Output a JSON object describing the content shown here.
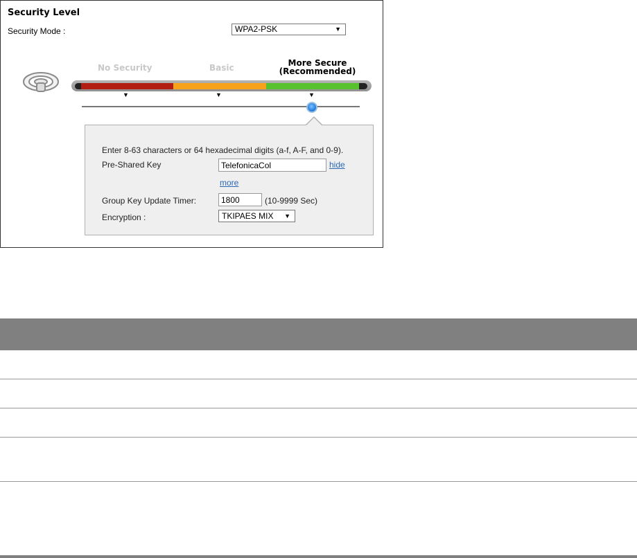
{
  "security_panel": {
    "title": "Security Level",
    "mode_label": "Security Mode :",
    "mode_value": "WPA2-PSK",
    "levels": {
      "none": "No Security",
      "basic": "Basic",
      "secure_line1": "More Secure",
      "secure_line2": "(Recommended)"
    },
    "selected_level": "More Secure",
    "colors": {
      "red": "#b31e12",
      "orange": "#f7a21a",
      "green": "#57c22d",
      "knob": "#1b78d9",
      "link": "#2a68b5"
    }
  },
  "details": {
    "hint": "Enter 8-63 characters or 64 hexadecimal digits (a-f, A-F, and 0-9).",
    "psk_label": "Pre-Shared Key",
    "psk_value": "TelefonicaCol",
    "hide_link": "hide",
    "more_link": "more",
    "timer_label": "Group Key Update Timer:",
    "timer_value": "1800",
    "timer_unit": "(10-9999 Sec)",
    "encryption_label": "Encryption :",
    "encryption_value": "TKIPAES MIX"
  },
  "icons": [
    "router-icon",
    "dropdown-arrow-icon",
    "slider-knob"
  ],
  "table": {
    "header_color": "#808080"
  }
}
